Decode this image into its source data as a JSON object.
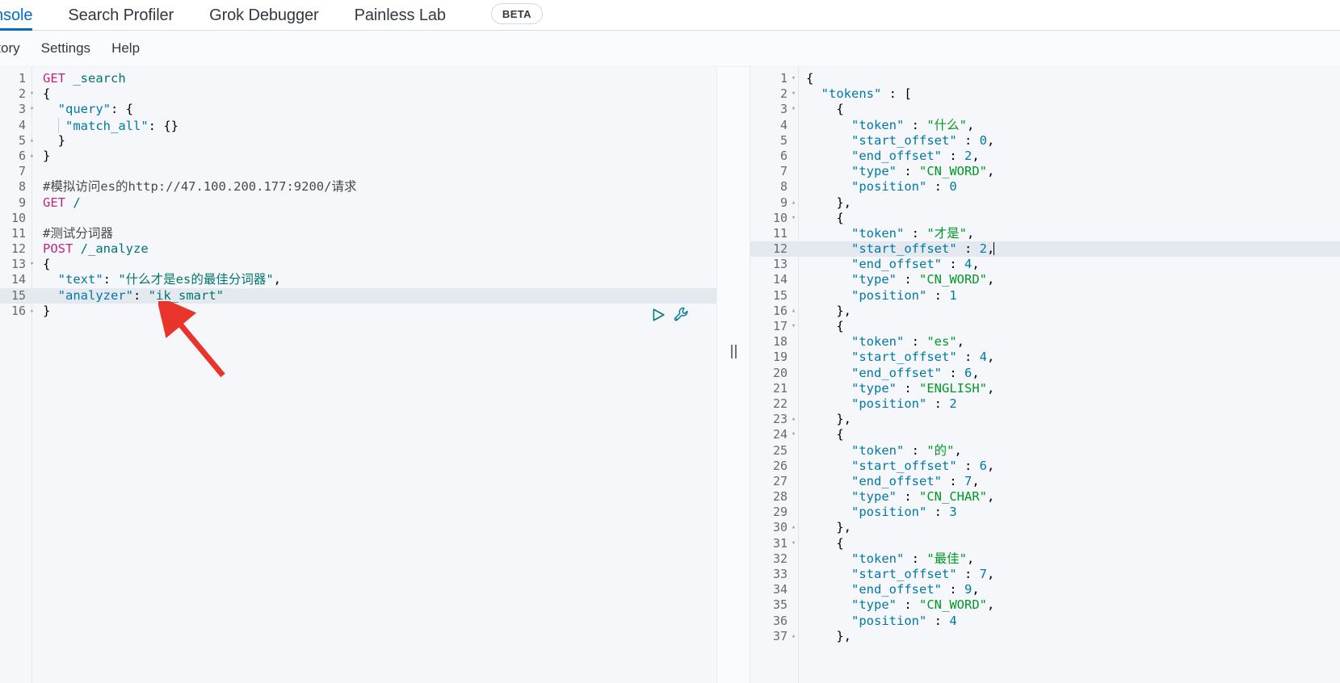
{
  "tabs": [
    {
      "label": "onsole",
      "active": true,
      "badge": null
    },
    {
      "label": "Search Profiler",
      "active": false,
      "badge": null
    },
    {
      "label": "Grok Debugger",
      "active": false,
      "badge": null
    },
    {
      "label": "Painless Lab",
      "active": false,
      "badge": "BETA"
    }
  ],
  "menu": [
    {
      "label": "istory"
    },
    {
      "label": "Settings"
    },
    {
      "label": "Help"
    }
  ],
  "icons": {
    "play": "play-icon",
    "wrench": "wrench-icon",
    "splitter": "splitter-handle",
    "arrow": "red-pointer-arrow"
  },
  "colors": {
    "accent": "#0071c2",
    "method": "#c0267e",
    "string": "#00776a",
    "response_string": "#009926",
    "key": "#0079a5",
    "annotation": "#e8342a",
    "play": "#017d73"
  },
  "request_editor": {
    "active_line": 15,
    "lines": [
      {
        "n": "1",
        "fold": "",
        "segs": [
          {
            "t": "GET ",
            "c": "kw"
          },
          {
            "t": "_search",
            "c": "url"
          }
        ]
      },
      {
        "n": "2",
        "fold": "▾",
        "segs": [
          {
            "t": "{",
            "c": "punct"
          }
        ]
      },
      {
        "n": "3",
        "fold": "▾",
        "segs": [
          {
            "t": "  ",
            "c": "punct"
          },
          {
            "t": "\"query\"",
            "c": "key"
          },
          {
            "t": ": {",
            "c": "punct"
          }
        ]
      },
      {
        "n": "4",
        "fold": "",
        "segs": [
          {
            "t": "  ",
            "c": "punct"
          },
          {
            "t": "|",
            "c": "guide"
          },
          {
            "t": " ",
            "c": "punct"
          },
          {
            "t": "\"match_all\"",
            "c": "key"
          },
          {
            "t": ": {}",
            "c": "punct"
          }
        ]
      },
      {
        "n": "5",
        "fold": "▴",
        "segs": [
          {
            "t": "  }",
            "c": "punct"
          }
        ]
      },
      {
        "n": "6",
        "fold": "▴",
        "segs": [
          {
            "t": "}",
            "c": "punct"
          }
        ]
      },
      {
        "n": "7",
        "fold": "",
        "segs": [
          {
            "t": "",
            "c": "punct"
          }
        ]
      },
      {
        "n": "8",
        "fold": "",
        "segs": [
          {
            "t": "#模拟访问es的http://47.100.200.177:9200/请求",
            "c": "comment"
          }
        ]
      },
      {
        "n": "9",
        "fold": "",
        "segs": [
          {
            "t": "GET ",
            "c": "kw"
          },
          {
            "t": "/",
            "c": "url"
          }
        ]
      },
      {
        "n": "10",
        "fold": "",
        "segs": [
          {
            "t": "",
            "c": "punct"
          }
        ]
      },
      {
        "n": "11",
        "fold": "",
        "segs": [
          {
            "t": "#测试分词器",
            "c": "comment"
          }
        ]
      },
      {
        "n": "12",
        "fold": "",
        "segs": [
          {
            "t": "POST ",
            "c": "kw"
          },
          {
            "t": "/_analyze",
            "c": "url"
          }
        ]
      },
      {
        "n": "13",
        "fold": "▾",
        "segs": [
          {
            "t": "{",
            "c": "punct"
          }
        ]
      },
      {
        "n": "14",
        "fold": "",
        "segs": [
          {
            "t": "  ",
            "c": "punct"
          },
          {
            "t": "\"text\"",
            "c": "key"
          },
          {
            "t": ": ",
            "c": "punct"
          },
          {
            "t": "\"什么才是es的最佳分词器\"",
            "c": "str"
          },
          {
            "t": ",",
            "c": "punct"
          }
        ]
      },
      {
        "n": "15",
        "fold": "",
        "segs": [
          {
            "t": "  ",
            "c": "punct"
          },
          {
            "t": "\"analyzer\"",
            "c": "key"
          },
          {
            "t": ": ",
            "c": "punct"
          },
          {
            "t": "\"ik_smart\"",
            "c": "str"
          }
        ]
      },
      {
        "n": "16",
        "fold": "▴",
        "segs": [
          {
            "t": "}",
            "c": "punct"
          }
        ]
      }
    ]
  },
  "response_editor": {
    "active_line": 12,
    "lines": [
      {
        "n": "1",
        "fold": "▾",
        "segs": [
          {
            "t": "{",
            "c": "punct"
          }
        ]
      },
      {
        "n": "2",
        "fold": "▾",
        "segs": [
          {
            "t": "  ",
            "c": "punct"
          },
          {
            "t": "\"tokens\"",
            "c": "rkey"
          },
          {
            "t": " : [",
            "c": "punct"
          }
        ]
      },
      {
        "n": "3",
        "fold": "▾",
        "segs": [
          {
            "t": "    ",
            "c": "punct"
          },
          {
            "t": "{",
            "c": "punct"
          }
        ]
      },
      {
        "n": "4",
        "fold": "",
        "segs": [
          {
            "t": "      ",
            "c": "punct"
          },
          {
            "t": "\"token\"",
            "c": "rkey"
          },
          {
            "t": " : ",
            "c": "punct"
          },
          {
            "t": "\"什么\"",
            "c": "rstr"
          },
          {
            "t": ",",
            "c": "punct"
          }
        ]
      },
      {
        "n": "5",
        "fold": "",
        "segs": [
          {
            "t": "      ",
            "c": "punct"
          },
          {
            "t": "\"start_offset\"",
            "c": "rkey"
          },
          {
            "t": " : ",
            "c": "punct"
          },
          {
            "t": "0",
            "c": "rnum"
          },
          {
            "t": ",",
            "c": "punct"
          }
        ]
      },
      {
        "n": "6",
        "fold": "",
        "segs": [
          {
            "t": "      ",
            "c": "punct"
          },
          {
            "t": "\"end_offset\"",
            "c": "rkey"
          },
          {
            "t": " : ",
            "c": "punct"
          },
          {
            "t": "2",
            "c": "rnum"
          },
          {
            "t": ",",
            "c": "punct"
          }
        ]
      },
      {
        "n": "7",
        "fold": "",
        "segs": [
          {
            "t": "      ",
            "c": "punct"
          },
          {
            "t": "\"type\"",
            "c": "rkey"
          },
          {
            "t": " : ",
            "c": "punct"
          },
          {
            "t": "\"CN_WORD\"",
            "c": "rstr"
          },
          {
            "t": ",",
            "c": "punct"
          }
        ]
      },
      {
        "n": "8",
        "fold": "",
        "segs": [
          {
            "t": "      ",
            "c": "punct"
          },
          {
            "t": "\"position\"",
            "c": "rkey"
          },
          {
            "t": " : ",
            "c": "punct"
          },
          {
            "t": "0",
            "c": "rnum"
          }
        ]
      },
      {
        "n": "9",
        "fold": "▴",
        "segs": [
          {
            "t": "    },",
            "c": "punct"
          }
        ]
      },
      {
        "n": "10",
        "fold": "▾",
        "segs": [
          {
            "t": "    {",
            "c": "punct"
          }
        ]
      },
      {
        "n": "11",
        "fold": "",
        "segs": [
          {
            "t": "      ",
            "c": "punct"
          },
          {
            "t": "\"token\"",
            "c": "rkey"
          },
          {
            "t": " : ",
            "c": "punct"
          },
          {
            "t": "\"才是\"",
            "c": "rstr"
          },
          {
            "t": ",",
            "c": "punct"
          }
        ]
      },
      {
        "n": "12",
        "fold": "",
        "segs": [
          {
            "t": "      ",
            "c": "punct"
          },
          {
            "t": "\"start_offset\"",
            "c": "rkey"
          },
          {
            "t": " : ",
            "c": "punct"
          },
          {
            "t": "2",
            "c": "rnum"
          },
          {
            "t": ",",
            "c": "punct"
          },
          {
            "t": "|",
            "c": "caret"
          }
        ]
      },
      {
        "n": "13",
        "fold": "",
        "segs": [
          {
            "t": "      ",
            "c": "punct"
          },
          {
            "t": "\"end_offset\"",
            "c": "rkey"
          },
          {
            "t": " : ",
            "c": "punct"
          },
          {
            "t": "4",
            "c": "rnum"
          },
          {
            "t": ",",
            "c": "punct"
          }
        ]
      },
      {
        "n": "14",
        "fold": "",
        "segs": [
          {
            "t": "      ",
            "c": "punct"
          },
          {
            "t": "\"type\"",
            "c": "rkey"
          },
          {
            "t": " : ",
            "c": "punct"
          },
          {
            "t": "\"CN_WORD\"",
            "c": "rstr"
          },
          {
            "t": ",",
            "c": "punct"
          }
        ]
      },
      {
        "n": "15",
        "fold": "",
        "segs": [
          {
            "t": "      ",
            "c": "punct"
          },
          {
            "t": "\"position\"",
            "c": "rkey"
          },
          {
            "t": " : ",
            "c": "punct"
          },
          {
            "t": "1",
            "c": "rnum"
          }
        ]
      },
      {
        "n": "16",
        "fold": "▴",
        "segs": [
          {
            "t": "    },",
            "c": "punct"
          }
        ]
      },
      {
        "n": "17",
        "fold": "▾",
        "segs": [
          {
            "t": "    {",
            "c": "punct"
          }
        ]
      },
      {
        "n": "18",
        "fold": "",
        "segs": [
          {
            "t": "      ",
            "c": "punct"
          },
          {
            "t": "\"token\"",
            "c": "rkey"
          },
          {
            "t": " : ",
            "c": "punct"
          },
          {
            "t": "\"es\"",
            "c": "rstr"
          },
          {
            "t": ",",
            "c": "punct"
          }
        ]
      },
      {
        "n": "19",
        "fold": "",
        "segs": [
          {
            "t": "      ",
            "c": "punct"
          },
          {
            "t": "\"start_offset\"",
            "c": "rkey"
          },
          {
            "t": " : ",
            "c": "punct"
          },
          {
            "t": "4",
            "c": "rnum"
          },
          {
            "t": ",",
            "c": "punct"
          }
        ]
      },
      {
        "n": "20",
        "fold": "",
        "segs": [
          {
            "t": "      ",
            "c": "punct"
          },
          {
            "t": "\"end_offset\"",
            "c": "rkey"
          },
          {
            "t": " : ",
            "c": "punct"
          },
          {
            "t": "6",
            "c": "rnum"
          },
          {
            "t": ",",
            "c": "punct"
          }
        ]
      },
      {
        "n": "21",
        "fold": "",
        "segs": [
          {
            "t": "      ",
            "c": "punct"
          },
          {
            "t": "\"type\"",
            "c": "rkey"
          },
          {
            "t": " : ",
            "c": "punct"
          },
          {
            "t": "\"ENGLISH\"",
            "c": "rstr"
          },
          {
            "t": ",",
            "c": "punct"
          }
        ]
      },
      {
        "n": "22",
        "fold": "",
        "segs": [
          {
            "t": "      ",
            "c": "punct"
          },
          {
            "t": "\"position\"",
            "c": "rkey"
          },
          {
            "t": " : ",
            "c": "punct"
          },
          {
            "t": "2",
            "c": "rnum"
          }
        ]
      },
      {
        "n": "23",
        "fold": "▴",
        "segs": [
          {
            "t": "    },",
            "c": "punct"
          }
        ]
      },
      {
        "n": "24",
        "fold": "▾",
        "segs": [
          {
            "t": "    {",
            "c": "punct"
          }
        ]
      },
      {
        "n": "25",
        "fold": "",
        "segs": [
          {
            "t": "      ",
            "c": "punct"
          },
          {
            "t": "\"token\"",
            "c": "rkey"
          },
          {
            "t": " : ",
            "c": "punct"
          },
          {
            "t": "\"的\"",
            "c": "rstr"
          },
          {
            "t": ",",
            "c": "punct"
          }
        ]
      },
      {
        "n": "26",
        "fold": "",
        "segs": [
          {
            "t": "      ",
            "c": "punct"
          },
          {
            "t": "\"start_offset\"",
            "c": "rkey"
          },
          {
            "t": " : ",
            "c": "punct"
          },
          {
            "t": "6",
            "c": "rnum"
          },
          {
            "t": ",",
            "c": "punct"
          }
        ]
      },
      {
        "n": "27",
        "fold": "",
        "segs": [
          {
            "t": "      ",
            "c": "punct"
          },
          {
            "t": "\"end_offset\"",
            "c": "rkey"
          },
          {
            "t": " : ",
            "c": "punct"
          },
          {
            "t": "7",
            "c": "rnum"
          },
          {
            "t": ",",
            "c": "punct"
          }
        ]
      },
      {
        "n": "28",
        "fold": "",
        "segs": [
          {
            "t": "      ",
            "c": "punct"
          },
          {
            "t": "\"type\"",
            "c": "rkey"
          },
          {
            "t": " : ",
            "c": "punct"
          },
          {
            "t": "\"CN_CHAR\"",
            "c": "rstr"
          },
          {
            "t": ",",
            "c": "punct"
          }
        ]
      },
      {
        "n": "29",
        "fold": "",
        "segs": [
          {
            "t": "      ",
            "c": "punct"
          },
          {
            "t": "\"position\"",
            "c": "rkey"
          },
          {
            "t": " : ",
            "c": "punct"
          },
          {
            "t": "3",
            "c": "rnum"
          }
        ]
      },
      {
        "n": "30",
        "fold": "▴",
        "segs": [
          {
            "t": "    },",
            "c": "punct"
          }
        ]
      },
      {
        "n": "31",
        "fold": "▾",
        "segs": [
          {
            "t": "    {",
            "c": "punct"
          }
        ]
      },
      {
        "n": "32",
        "fold": "",
        "segs": [
          {
            "t": "      ",
            "c": "punct"
          },
          {
            "t": "\"token\"",
            "c": "rkey"
          },
          {
            "t": " : ",
            "c": "punct"
          },
          {
            "t": "\"最佳\"",
            "c": "rstr"
          },
          {
            "t": ",",
            "c": "punct"
          }
        ]
      },
      {
        "n": "33",
        "fold": "",
        "segs": [
          {
            "t": "      ",
            "c": "punct"
          },
          {
            "t": "\"start_offset\"",
            "c": "rkey"
          },
          {
            "t": " : ",
            "c": "punct"
          },
          {
            "t": "7",
            "c": "rnum"
          },
          {
            "t": ",",
            "c": "punct"
          }
        ]
      },
      {
        "n": "34",
        "fold": "",
        "segs": [
          {
            "t": "      ",
            "c": "punct"
          },
          {
            "t": "\"end_offset\"",
            "c": "rkey"
          },
          {
            "t": " : ",
            "c": "punct"
          },
          {
            "t": "9",
            "c": "rnum"
          },
          {
            "t": ",",
            "c": "punct"
          }
        ]
      },
      {
        "n": "35",
        "fold": "",
        "segs": [
          {
            "t": "      ",
            "c": "punct"
          },
          {
            "t": "\"type\"",
            "c": "rkey"
          },
          {
            "t": " : ",
            "c": "punct"
          },
          {
            "t": "\"CN_WORD\"",
            "c": "rstr"
          },
          {
            "t": ",",
            "c": "punct"
          }
        ]
      },
      {
        "n": "36",
        "fold": "",
        "segs": [
          {
            "t": "      ",
            "c": "punct"
          },
          {
            "t": "\"position\"",
            "c": "rkey"
          },
          {
            "t": " : ",
            "c": "punct"
          },
          {
            "t": "4",
            "c": "rnum"
          }
        ]
      },
      {
        "n": "37",
        "fold": "▴",
        "segs": [
          {
            "t": "    },",
            "c": "punct"
          }
        ]
      }
    ]
  }
}
